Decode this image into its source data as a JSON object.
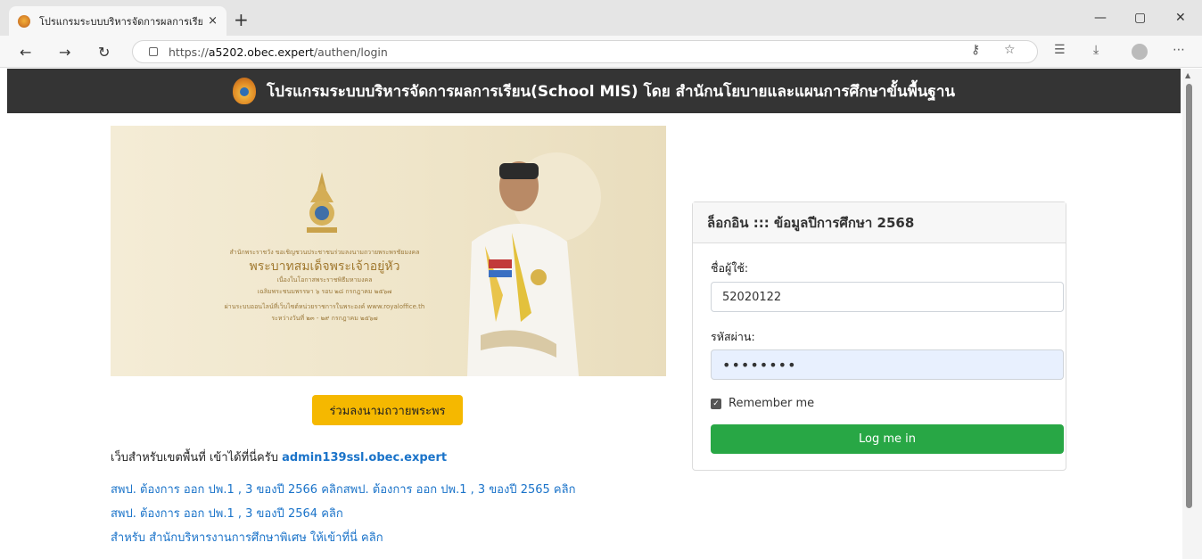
{
  "browser": {
    "tab_title": "โปรแกรมระบบบริหารจัดการผลการเรียน",
    "tab_close": "×",
    "new_tab": "+",
    "url_prefix": "https://",
    "url_host": "a5202.obec.expert",
    "url_path": "/authen/login",
    "window_minimize": "—",
    "window_restore": "▢",
    "window_close": "✕",
    "icons": [
      "back-icon",
      "forward-icon",
      "refresh-icon",
      "lock-icon",
      "key-icon",
      "favorite-icon",
      "collections-icon",
      "download-icon",
      "profile-icon",
      "more-icon"
    ]
  },
  "header": {
    "title": "โปรแกรมระบบบริหารจัดการผลการเรียน(School MIS) โดย สำนักนโยบายและแผนการศึกษาขั้นพื้นฐาน"
  },
  "banner": {
    "line1": "สำนักพระราชวัง ขอเชิญชวนประชาชนร่วมลงนามถวายพระพรชัยมงคล",
    "line2": "พระบาทสมเด็จพระเจ้าอยู่หัว",
    "line3": "เนื่องในโอกาสพระราชพิธีมหามงคล",
    "line4": "เฉลิมพระชนมพรรษา ๖ รอบ ๒๘ กรกฎาคม ๒๕๖๗",
    "line5": "ผ่านระบบออนไลน์ที่เว็บไซต์หน่วยราชการในพระองค์ www.royaloffice.th",
    "line6": "ระหว่างวันที่ ๒๓ - ๒๙ กรกฎาคม ๒๕๖๗"
  },
  "donate_button": "ร่วมลงนามถวายพระพร",
  "info": {
    "area_text": "เว็บสำหรับเขตพื้นที่ เข้าได้ที่นี่ครับ ",
    "area_link": "admin139ssl.obec.expert",
    "link1": "สพป. ต้องการ ออก ปพ.1 , 3 ของปี 2566 คลิก",
    "link2": "สพป. ต้องการ ออก ปพ.1 , 3 ของปี 2565 คลิก",
    "link3": "สพป. ต้องการ ออก ปพ.1 , 3 ของปี 2564 คลิก",
    "link4": "สำหรับ สำนักบริหารงานการศึกษาพิเศษ ให้เข้าที่นี่ คลิก"
  },
  "login": {
    "title": "ล็อกอิน ::: ข้อมูลปีการศึกษา 2568",
    "username_label": "ชื่อผู้ใช้:",
    "username_value": "52020122",
    "password_label": "รหัสผ่าน:",
    "password_value": "••••••••",
    "remember_label": "Remember me",
    "remember_checked": true,
    "submit_label": "Log me in"
  },
  "colors": {
    "header_bg": "#343434",
    "donate_bg": "#f5b800",
    "login_btn": "#28a745",
    "link": "#1a73c9"
  }
}
